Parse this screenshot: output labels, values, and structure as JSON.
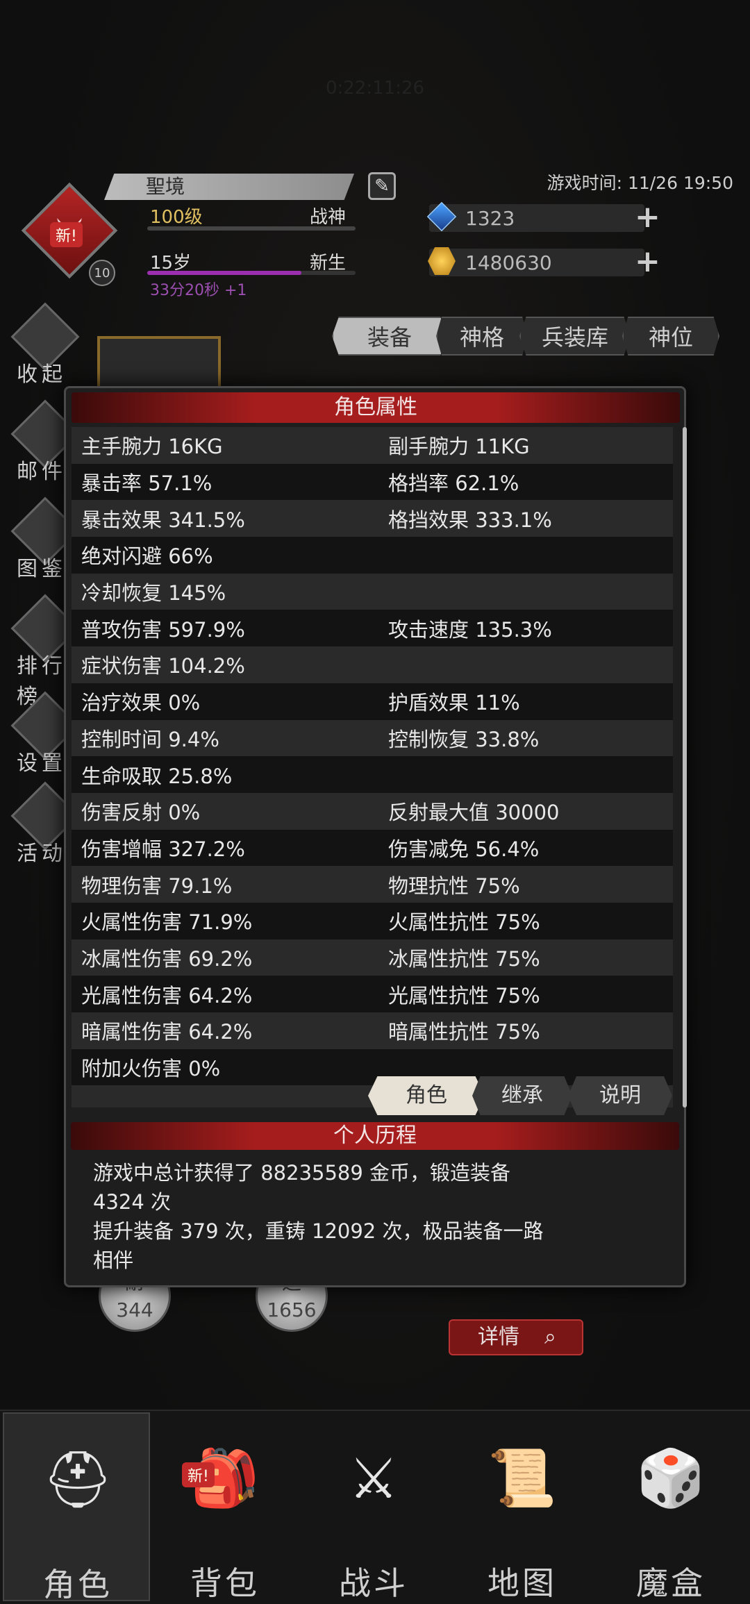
{
  "status_bar_faded": "0:22:11:26",
  "player": {
    "name": "聖境",
    "level": "100级",
    "title": "战神",
    "age": "15岁",
    "stage": "新生",
    "timer": "33分20秒 +1",
    "badge_level": "10",
    "new_tag": "新!"
  },
  "game_time": "游戏时间: 11/26 19:50",
  "resources": [
    {
      "icon": "blue-gem-icon",
      "value": "1323"
    },
    {
      "icon": "gold-coin-icon",
      "value": "1480630"
    }
  ],
  "side_menu": [
    {
      "label": "收起",
      "icon": "collapse-icon"
    },
    {
      "label": "邮件",
      "icon": "mail-icon"
    },
    {
      "label": "图鉴",
      "icon": "book-icon"
    },
    {
      "label": "排行榜",
      "icon": "ranking-icon"
    },
    {
      "label": "设置",
      "icon": "gear-icon"
    },
    {
      "label": "活动",
      "icon": "activity-icon"
    }
  ],
  "tabs": [
    "装备",
    "神格",
    "兵装库",
    "神位"
  ],
  "modal": {
    "title": "角色属性",
    "rows": [
      {
        "l": "主手腕力   16KG",
        "r": "副手腕力   11KG"
      },
      {
        "l": "暴击率   57.1%",
        "r": "格挡率   62.1%"
      },
      {
        "l": "暴击效果   341.5%",
        "r": "格挡效果   333.1%"
      },
      {
        "l": "绝对闪避   66%",
        "r": ""
      },
      {
        "l": "冷却恢复   145%",
        "r": ""
      },
      {
        "l": "普攻伤害   597.9%",
        "r": "攻击速度   135.3%"
      },
      {
        "l": "症状伤害   104.2%",
        "r": ""
      },
      {
        "l": "治疗效果   0%",
        "r": "护盾效果   11%"
      },
      {
        "l": "控制时间   9.4%",
        "r": "控制恢复   33.8%"
      },
      {
        "l": "生命吸取   25.8%",
        "r": ""
      },
      {
        "l": "伤害反射   0%",
        "r": "反射最大值   30000"
      },
      {
        "l": "伤害增幅   327.2%",
        "r": "伤害减免   56.4%"
      },
      {
        "l": "物理伤害   79.1%",
        "r": "物理抗性   75%"
      },
      {
        "l": "火属性伤害   71.9%",
        "r": "火属性抗性   75%"
      },
      {
        "l": "冰属性伤害   69.2%",
        "r": "冰属性抗性   75%"
      },
      {
        "l": "光属性伤害   64.2%",
        "r": "光属性抗性   75%"
      },
      {
        "l": "暗属性伤害   64.2%",
        "r": "暗属性抗性   75%"
      },
      {
        "l": "附加火伤害   0%",
        "r": ""
      },
      {
        "l": "",
        "r": ""
      }
    ],
    "subtabs": [
      "角色",
      "继承",
      "说明"
    ],
    "history_title": "个人历程",
    "history_lines": [
      "游戏中总计获得了 88235589 金币，锻造装备",
      "4324 次",
      "提升装备 379 次，重铸 12092 次，极品装备一路",
      "相伴"
    ]
  },
  "stats": [
    {
      "label": "耐",
      "value": "344"
    },
    {
      "label": "运",
      "value": "1656"
    }
  ],
  "detail_button": "详情",
  "bottom_nav": [
    {
      "label": "角色",
      "icon": "helmet-icon",
      "active": true
    },
    {
      "label": "背包",
      "icon": "backpack-icon",
      "active": false,
      "tag": "新!"
    },
    {
      "label": "战斗",
      "icon": "sword-shield-icon",
      "active": false
    },
    {
      "label": "地图",
      "icon": "scroll-map-icon",
      "active": false
    },
    {
      "label": "魔盒",
      "icon": "magic-box-icon",
      "active": false
    }
  ]
}
